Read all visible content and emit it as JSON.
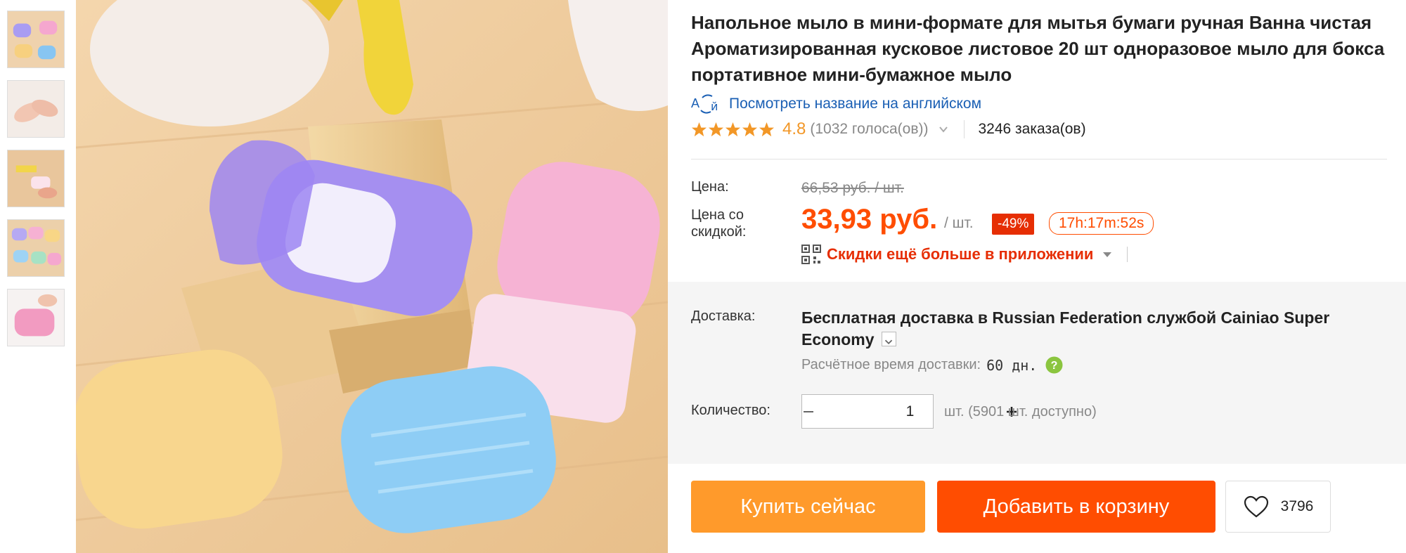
{
  "product": {
    "title": "Напольное мыло в мини-формате для мытья бумаги ручная Ванна чистая Ароматизированная кусковое листовое 20 шт одноразовое мыло для бокса портативное мини-бумажное мыло",
    "translate_link": "Посмотреть название на английском",
    "rating": "4.8",
    "votes": "(1032 голоса(ов))",
    "orders": "3246 заказа(ов)"
  },
  "price": {
    "label": "Цена:",
    "original": "66,53 руб. / шт.",
    "discount_label": "Цена со скидкой:",
    "current": "33,93 руб.",
    "per_unit": "/ шт.",
    "discount_badge": "-49%",
    "timer": "17h:17m:52s",
    "app_promo": "Скидки ещё больше в приложении"
  },
  "shipping": {
    "label": "Доставка:",
    "text_prefix": "Бесплатная доставка в ",
    "destination": "Russian Federation",
    "text_suffix": " службой Cainiao Super Economy",
    "eta_label": "Расчётное время доставки:",
    "eta_value": "60 дн."
  },
  "quantity": {
    "label": "Количество:",
    "value": "1",
    "available": "шт. (5901 шт. доступно)"
  },
  "actions": {
    "buy_now": "Купить сейчас",
    "add_to_cart": "Добавить в корзину",
    "wishlist_count": "3796"
  },
  "colors": {
    "accent": "#ff4d01",
    "buy_now": "#ff9a2b",
    "link": "#1a5fb4",
    "rating": "#f29727",
    "badge": "#e62e04",
    "panel": "#f5f5f5"
  },
  "icons": {
    "translate": "translate-icon",
    "star": "star-icon",
    "chevron": "chevron-down-icon",
    "qr": "qr-code-icon",
    "help": "help-icon",
    "minus": "minus-icon",
    "plus": "plus-icon",
    "heart": "heart-icon"
  },
  "gallery": {
    "thumbnail_count": 5,
    "selected_thumbnail": 1
  }
}
